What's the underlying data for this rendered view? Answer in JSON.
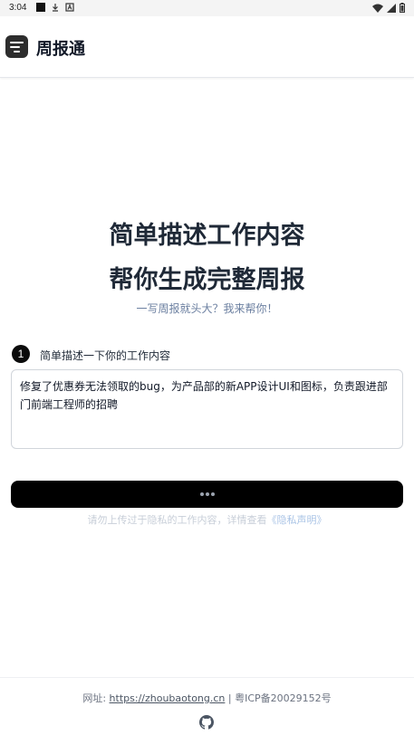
{
  "status_bar": {
    "time": "3:04",
    "icons": [
      "notification-square-icon",
      "download-icon",
      "a-box-icon",
      "wifi-icon",
      "signal-icon",
      "battery-icon"
    ]
  },
  "app": {
    "title": "周报通",
    "logo_icon": "list-lines-icon"
  },
  "hero": {
    "line1": "简单描述工作内容",
    "line2": "帮你生成完整周报",
    "subtitle": "一写周报就头大？我来帮你！"
  },
  "step": {
    "number": "1",
    "label": "简单描述一下你的工作内容"
  },
  "input": {
    "value": "修复了优惠券无法领取的bug，为产品部的新APP设计UI和图标，负责跟进部门前端工程师的招聘"
  },
  "generate_button": {
    "state": "loading",
    "indicator_icon": "loading-dots-icon"
  },
  "privacy": {
    "text": "请勿上传过于隐私的工作内容，详情查看",
    "link": "《隐私声明》"
  },
  "footer": {
    "url_label": "网址:",
    "url": "https://zhoubaotong.cn",
    "separator": "|",
    "icp": "粤ICP备20029152号",
    "icon": "github-icon"
  },
  "colors": {
    "accent": "#000000",
    "subtitle": "#6b7fa0",
    "privacy_text": "#c7ced8",
    "privacy_link": "#aac4e6"
  }
}
